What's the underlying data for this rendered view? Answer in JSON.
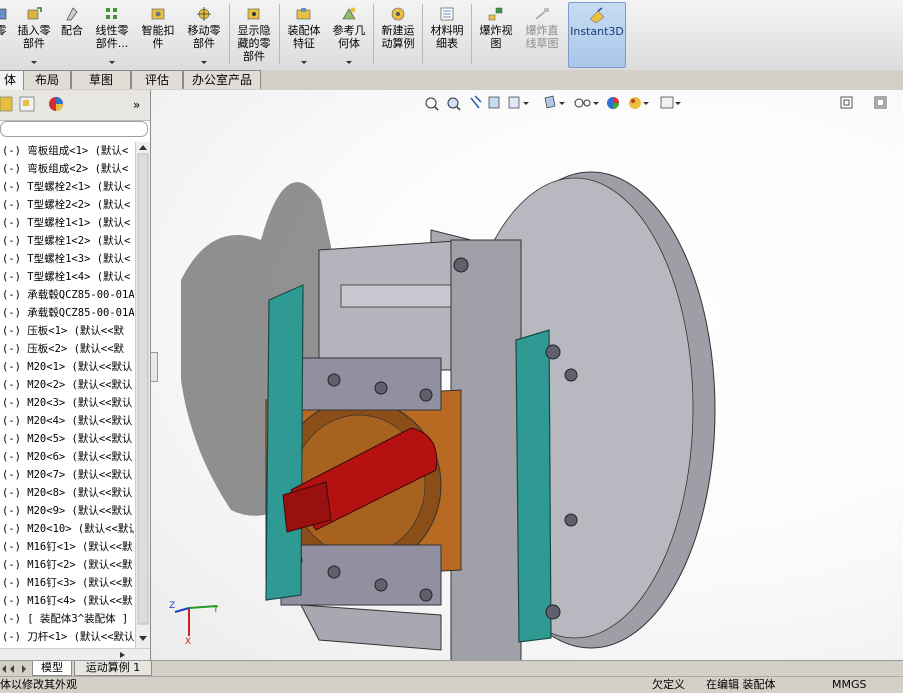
{
  "ribbon": {
    "buttons": [
      {
        "label": "零",
        "icon": "component-icon"
      },
      {
        "label": "插入零\n部件",
        "icon": "insert-component-icon"
      },
      {
        "label": "配合",
        "icon": "mate-icon"
      },
      {
        "label": "线性零\n部件...",
        "icon": "linear-pattern-icon"
      },
      {
        "label": "智能扣\n件",
        "icon": "smart-fastener-icon"
      },
      {
        "label": "移动零\n部件",
        "icon": "move-component-icon"
      },
      {
        "label": "显示隐\n藏的零\n部件",
        "icon": "show-hidden-icon"
      },
      {
        "label": "装配体\n特征",
        "icon": "assembly-feature-icon"
      },
      {
        "label": "参考几\n何体",
        "icon": "reference-geometry-icon"
      },
      {
        "label": "新建运\n动算例",
        "icon": "new-motion-study-icon"
      },
      {
        "label": "材料明\n细表",
        "icon": "bill-of-materials-icon"
      },
      {
        "label": "爆炸视\n图",
        "icon": "exploded-view-icon"
      },
      {
        "label": "爆炸直\n线草图",
        "icon": "explode-line-sketch-icon"
      },
      {
        "label": "Instant3D",
        "icon": "instant3d-icon"
      }
    ]
  },
  "tabs": [
    "体",
    "布局",
    "草图",
    "评估",
    "办公室产品"
  ],
  "tree": {
    "items": [
      "(-) 弯板组成<1> (默认<",
      "(-) 弯板组成<2> (默认<",
      "(-) T型螺栓2<1> (默认<",
      "(-) T型螺栓2<2> (默认<",
      "(-) T型螺栓1<1> (默认<",
      "(-) T型螺栓1<2> (默认<",
      "(-) T型螺栓1<3> (默认<",
      "(-) T型螺栓1<4> (默认<",
      "(-) 承载毂QCZ85-00-01A",
      "(-) 承载毂QCZ85-00-01A",
      "(-) 压板<1> (默认<<默",
      "(-) 压板<2> (默认<<默",
      "(-) M20<1> (默认<<默认",
      "(-) M20<2> (默认<<默认",
      "(-) M20<3> (默认<<默认",
      "(-) M20<4> (默认<<默认",
      "(-) M20<5> (默认<<默认",
      "(-) M20<6> (默认<<默认",
      "(-) M20<7> (默认<<默认",
      "(-) M20<8> (默认<<默认",
      "(-) M20<9> (默认<<默认",
      "(-) M20<10> (默认<<默认",
      "(-) M16钉<1> (默认<<默",
      "(-) M16钉<2> (默认<<默",
      "(-) M16钉<3> (默认<<默",
      "(-) M16钉<4> (默认<<默",
      "(-) [ 装配体3^装配体 ]",
      "(-) 刀杆<1> (默认<<默认"
    ]
  },
  "triad": {
    "x": "X",
    "y": "Y",
    "z": "Z"
  },
  "bottom_tabs": [
    "模型",
    "运动算例 1"
  ],
  "status": {
    "left": "体以修改其外观",
    "definition": "欠定义",
    "editing": "在编辑 装配体",
    "units": "MMGS"
  },
  "colors": {
    "teal": "#2f9a93",
    "bronze": "#b86a22",
    "red": "#b51111",
    "steel": "#9e9ea6"
  }
}
